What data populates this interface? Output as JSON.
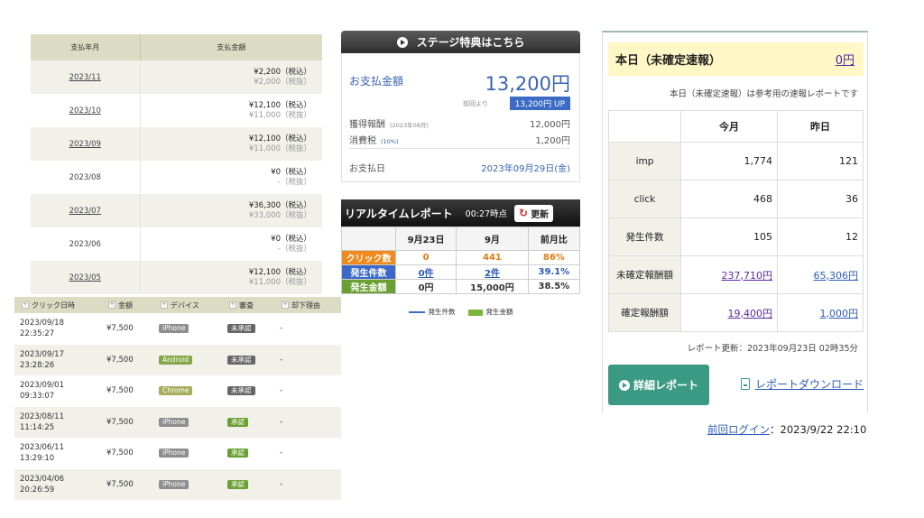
{
  "payment_history": {
    "headers": [
      "支払年月",
      "支払金額"
    ],
    "rows": [
      {
        "month": "2023/11",
        "linked": true,
        "tax_in": "¥2,200（税込）",
        "tax_ex": "¥2,000（税抜）"
      },
      {
        "month": "2023/10",
        "linked": true,
        "tax_in": "¥12,100（税込）",
        "tax_ex": "¥11,000（税抜）"
      },
      {
        "month": "2023/09",
        "linked": true,
        "tax_in": "¥12,100（税込）",
        "tax_ex": "¥11,000（税抜）"
      },
      {
        "month": "2023/08",
        "linked": false,
        "tax_in": "¥0（税込）",
        "tax_ex": "-（税抜）"
      },
      {
        "month": "2023/07",
        "linked": true,
        "tax_in": "¥36,300（税込）",
        "tax_ex": "¥33,000（税抜）"
      },
      {
        "month": "2023/06",
        "linked": false,
        "tax_in": "¥0（税込）",
        "tax_ex": "-（税抜）"
      },
      {
        "month": "2023/05",
        "linked": true,
        "tax_in": "¥12,100（税込）",
        "tax_ex": "¥11,000（税抜）"
      }
    ]
  },
  "click_log": {
    "headers": [
      "クリック日時",
      "金額",
      "デバイス",
      "審査",
      "却下理由"
    ],
    "rows": [
      {
        "date": "2023/09/18",
        "time": "22:35:27",
        "amount": "¥7,500",
        "device": "iPhone",
        "device_type": "iphone",
        "status": "未承認",
        "status_type": "pend",
        "reason": "-"
      },
      {
        "date": "2023/09/17",
        "time": "23:28:26",
        "amount": "¥7,500",
        "device": "Android",
        "device_type": "android",
        "status": "未承認",
        "status_type": "pend",
        "reason": "-"
      },
      {
        "date": "2023/09/01",
        "time": "09:33:07",
        "amount": "¥7,500",
        "device": "Chrome",
        "device_type": "chrome",
        "status": "未承認",
        "status_type": "pend",
        "reason": "-"
      },
      {
        "date": "2023/08/11",
        "time": "11:14:25",
        "amount": "¥7,500",
        "device": "iPhone",
        "device_type": "iphone",
        "status": "承認",
        "status_type": "ok",
        "reason": "-"
      },
      {
        "date": "2023/06/11",
        "time": "13:29:10",
        "amount": "¥7,500",
        "device": "iPhone",
        "device_type": "iphone",
        "status": "承認",
        "status_type": "ok",
        "reason": "-"
      },
      {
        "date": "2023/04/06",
        "time": "20:26:59",
        "amount": "¥7,500",
        "device": "iPhone",
        "device_type": "iphone",
        "status": "承認",
        "status_type": "ok",
        "reason": "-"
      }
    ]
  },
  "stage_button": {
    "label": "ステージ特典はこちら",
    "icon": "play-circle-icon"
  },
  "payment_box": {
    "title": "お支払金額",
    "amount": "13,200円",
    "prev_label": "前回より",
    "change": "13,200円 UP",
    "earned_label": "獲得報酬",
    "earned_note": "(2023年08月)",
    "earned_value": "12,000円",
    "tax_label": "消費税",
    "tax_note": "(10%)",
    "tax_value": "1,200円",
    "date_label": "お支払日",
    "date_value": "2023年09月29日(金)"
  },
  "realtime": {
    "title": "リアルタイムレポート",
    "time": "00:27時点",
    "refresh_label": "更新",
    "columns": [
      "9月23日",
      "9月",
      "前月比"
    ],
    "rows": [
      {
        "label": "クリック数",
        "color": "o",
        "day": "0",
        "month": "441",
        "ratio": "86%"
      },
      {
        "label": "発生件数",
        "color": "b",
        "day": "0件",
        "month": "2件",
        "ratio": "39.1%"
      },
      {
        "label": "発生金額",
        "color": "g",
        "day": "0円",
        "month": "15,000円",
        "ratio": "38.5%"
      }
    ],
    "legend": [
      "発生件数",
      "発生金額"
    ]
  },
  "today": {
    "title": "本日（未確定速報）",
    "amount": "0円",
    "note": "本日（未確定速報）は参考用の速報レポートです",
    "columns": [
      "今月",
      "昨日"
    ],
    "rows": [
      {
        "label": "imp",
        "month": "1,774",
        "yesterday": "121",
        "link": ""
      },
      {
        "label": "click",
        "month": "468",
        "yesterday": "36",
        "link": ""
      },
      {
        "label": "発生件数",
        "month": "105",
        "yesterday": "12",
        "link": ""
      },
      {
        "label": "未確定報酬額",
        "month": "237,710円",
        "yesterday": "65,306円",
        "link": "y"
      },
      {
        "label": "確定報酬額",
        "month": "19,400円",
        "yesterday": "1,000円",
        "link": "y"
      }
    ],
    "updated": "レポート更新：2023年09月23日 02時35分",
    "detail_label": "詳細レポート",
    "download_label": "レポートダウンロード"
  },
  "last_login": {
    "label": "前回ログイン",
    "value": "：2023/9/22 22:10"
  }
}
